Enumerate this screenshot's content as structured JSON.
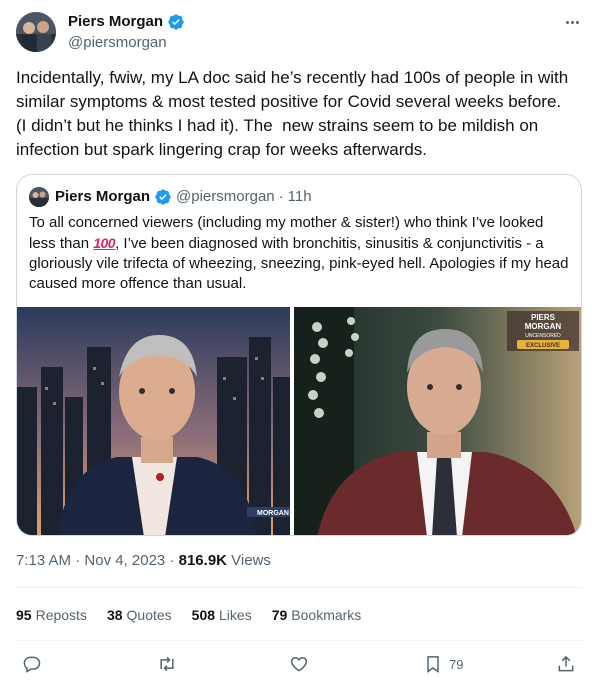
{
  "author": {
    "name": "Piers Morgan",
    "handle": "@piersmorgan"
  },
  "tweet": {
    "text": "Incidentally, fwiw, my LA doc said he’s recently had 100s of people in with similar symptoms & most tested positive for Covid several weeks before. (I didn’t but he thinks I had it). The  new strains seem to be mildish on infection but spark lingering crap for weeks afterwards.",
    "time": "7:13 AM",
    "date_separator": "·",
    "date": "Nov 4, 2023",
    "views_separator": "·",
    "views_count": "816.9K",
    "views_label": "Views"
  },
  "quote": {
    "name": "Piers Morgan",
    "handle": "@piersmorgan",
    "separator": "·",
    "age": "11h",
    "text_before": "To all concerned viewers (including my mother & sister!) who think I’ve looked less than ",
    "emoji": "100",
    "text_after": ", I’ve been diagnosed with bronchitis, sinusitis & conjunctivitis - a gloriously vile trifecta of wheezing, sneezing, pink-eyed hell. Apologies if my head caused more offence than usual.",
    "media": {
      "logo_line1": "PIERS",
      "logo_line2": "MORGAN",
      "logo_line3": "UNCENSORED",
      "badge": "EXCLUSIVE",
      "lower_tag": "MORGAN"
    }
  },
  "stats": {
    "reposts_count": "95",
    "reposts_label": "Reposts",
    "quotes_count": "38",
    "quotes_label": "Quotes",
    "likes_count": "508",
    "likes_label": "Likes",
    "bookmarks_count": "79",
    "bookmarks_label": "Bookmarks"
  },
  "actions": {
    "bookmark_count": "79"
  },
  "colors": {
    "verified": "#1d9bf0",
    "text": "#0f1419",
    "secondary": "#536471",
    "border": "#cfd9de"
  },
  "icons": [
    "verified-badge-icon",
    "more-icon",
    "reply-icon",
    "repost-icon",
    "like-icon",
    "bookmark-icon",
    "share-icon"
  ]
}
